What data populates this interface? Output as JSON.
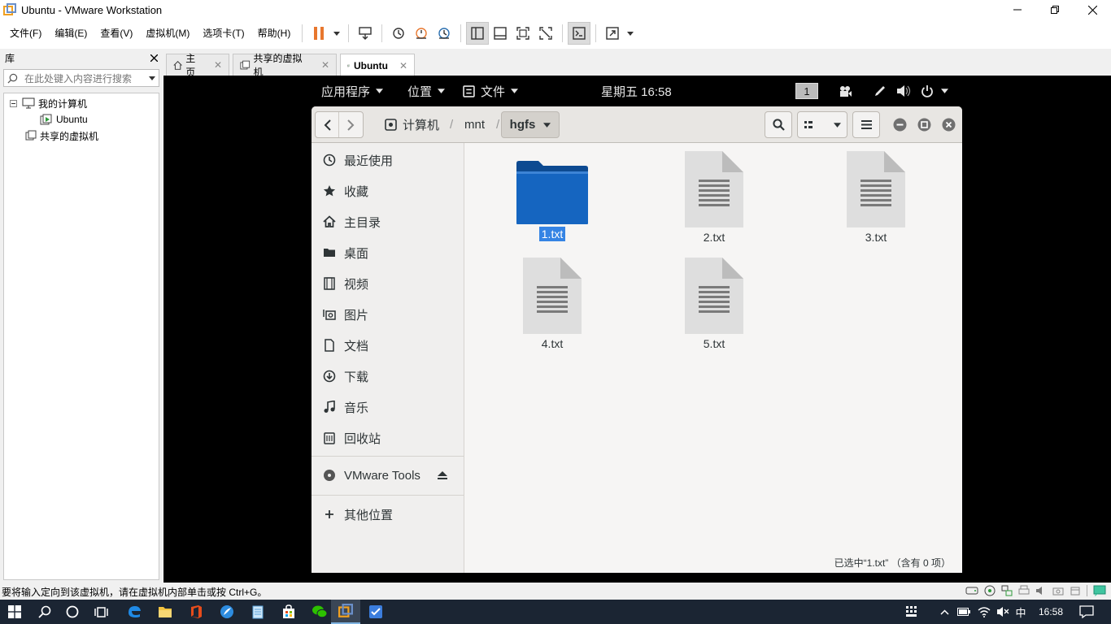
{
  "window": {
    "title": "Ubuntu - VMware Workstation",
    "controls": {
      "minimize": "minimize-icon",
      "maximize": "maximize-icon",
      "close": "close-icon"
    }
  },
  "menu": {
    "file": "文件(F)",
    "edit": "编辑(E)",
    "view": "查看(V)",
    "vm": "虚拟机(M)",
    "tabs": "选项卡(T)",
    "help": "帮助(H)"
  },
  "library": {
    "title": "库",
    "search_placeholder": "在此处键入内容进行搜索",
    "tree": {
      "my_computer": "我的计算机",
      "ubuntu": "Ubuntu",
      "shared": "共享的虚拟机"
    }
  },
  "tabs": [
    {
      "label": "主页"
    },
    {
      "label": "共享的虚拟机"
    },
    {
      "label": "Ubuntu"
    }
  ],
  "gnome": {
    "apps": "应用程序",
    "places": "位置",
    "files": "文件",
    "clock": "星期五 16:58",
    "workspace": "1"
  },
  "nautilus": {
    "breadcrumbs": {
      "computer": "计算机",
      "mnt": "mnt",
      "hgfs": "hgfs"
    },
    "sidebar": {
      "recent": "最近使用",
      "starred": "收藏",
      "home": "主目录",
      "desktop": "桌面",
      "videos": "视频",
      "pictures": "图片",
      "documents": "文档",
      "downloads": "下载",
      "music": "音乐",
      "trash": "回收站",
      "vmware_tools": "VMware Tools",
      "other": "其他位置"
    },
    "files": [
      {
        "name": "1.txt",
        "type": "folder",
        "selected": true
      },
      {
        "name": "2.txt",
        "type": "text"
      },
      {
        "name": "3.txt",
        "type": "text"
      },
      {
        "name": "4.txt",
        "type": "text"
      },
      {
        "name": "5.txt",
        "type": "text"
      }
    ],
    "status": "已选中“1.txt” （含有 0 项）"
  },
  "statusbar": {
    "message": "要将输入定向到该虚拟机，请在虚拟机内部单击或按 Ctrl+G。"
  },
  "taskbar": {
    "ime": "中",
    "time": "16:58"
  },
  "colors": {
    "selection": "#3584e4",
    "folder": "#1565c0",
    "gnome_bar": "#000000",
    "taskbar": "#1b2533",
    "pause": "#e8772e"
  }
}
